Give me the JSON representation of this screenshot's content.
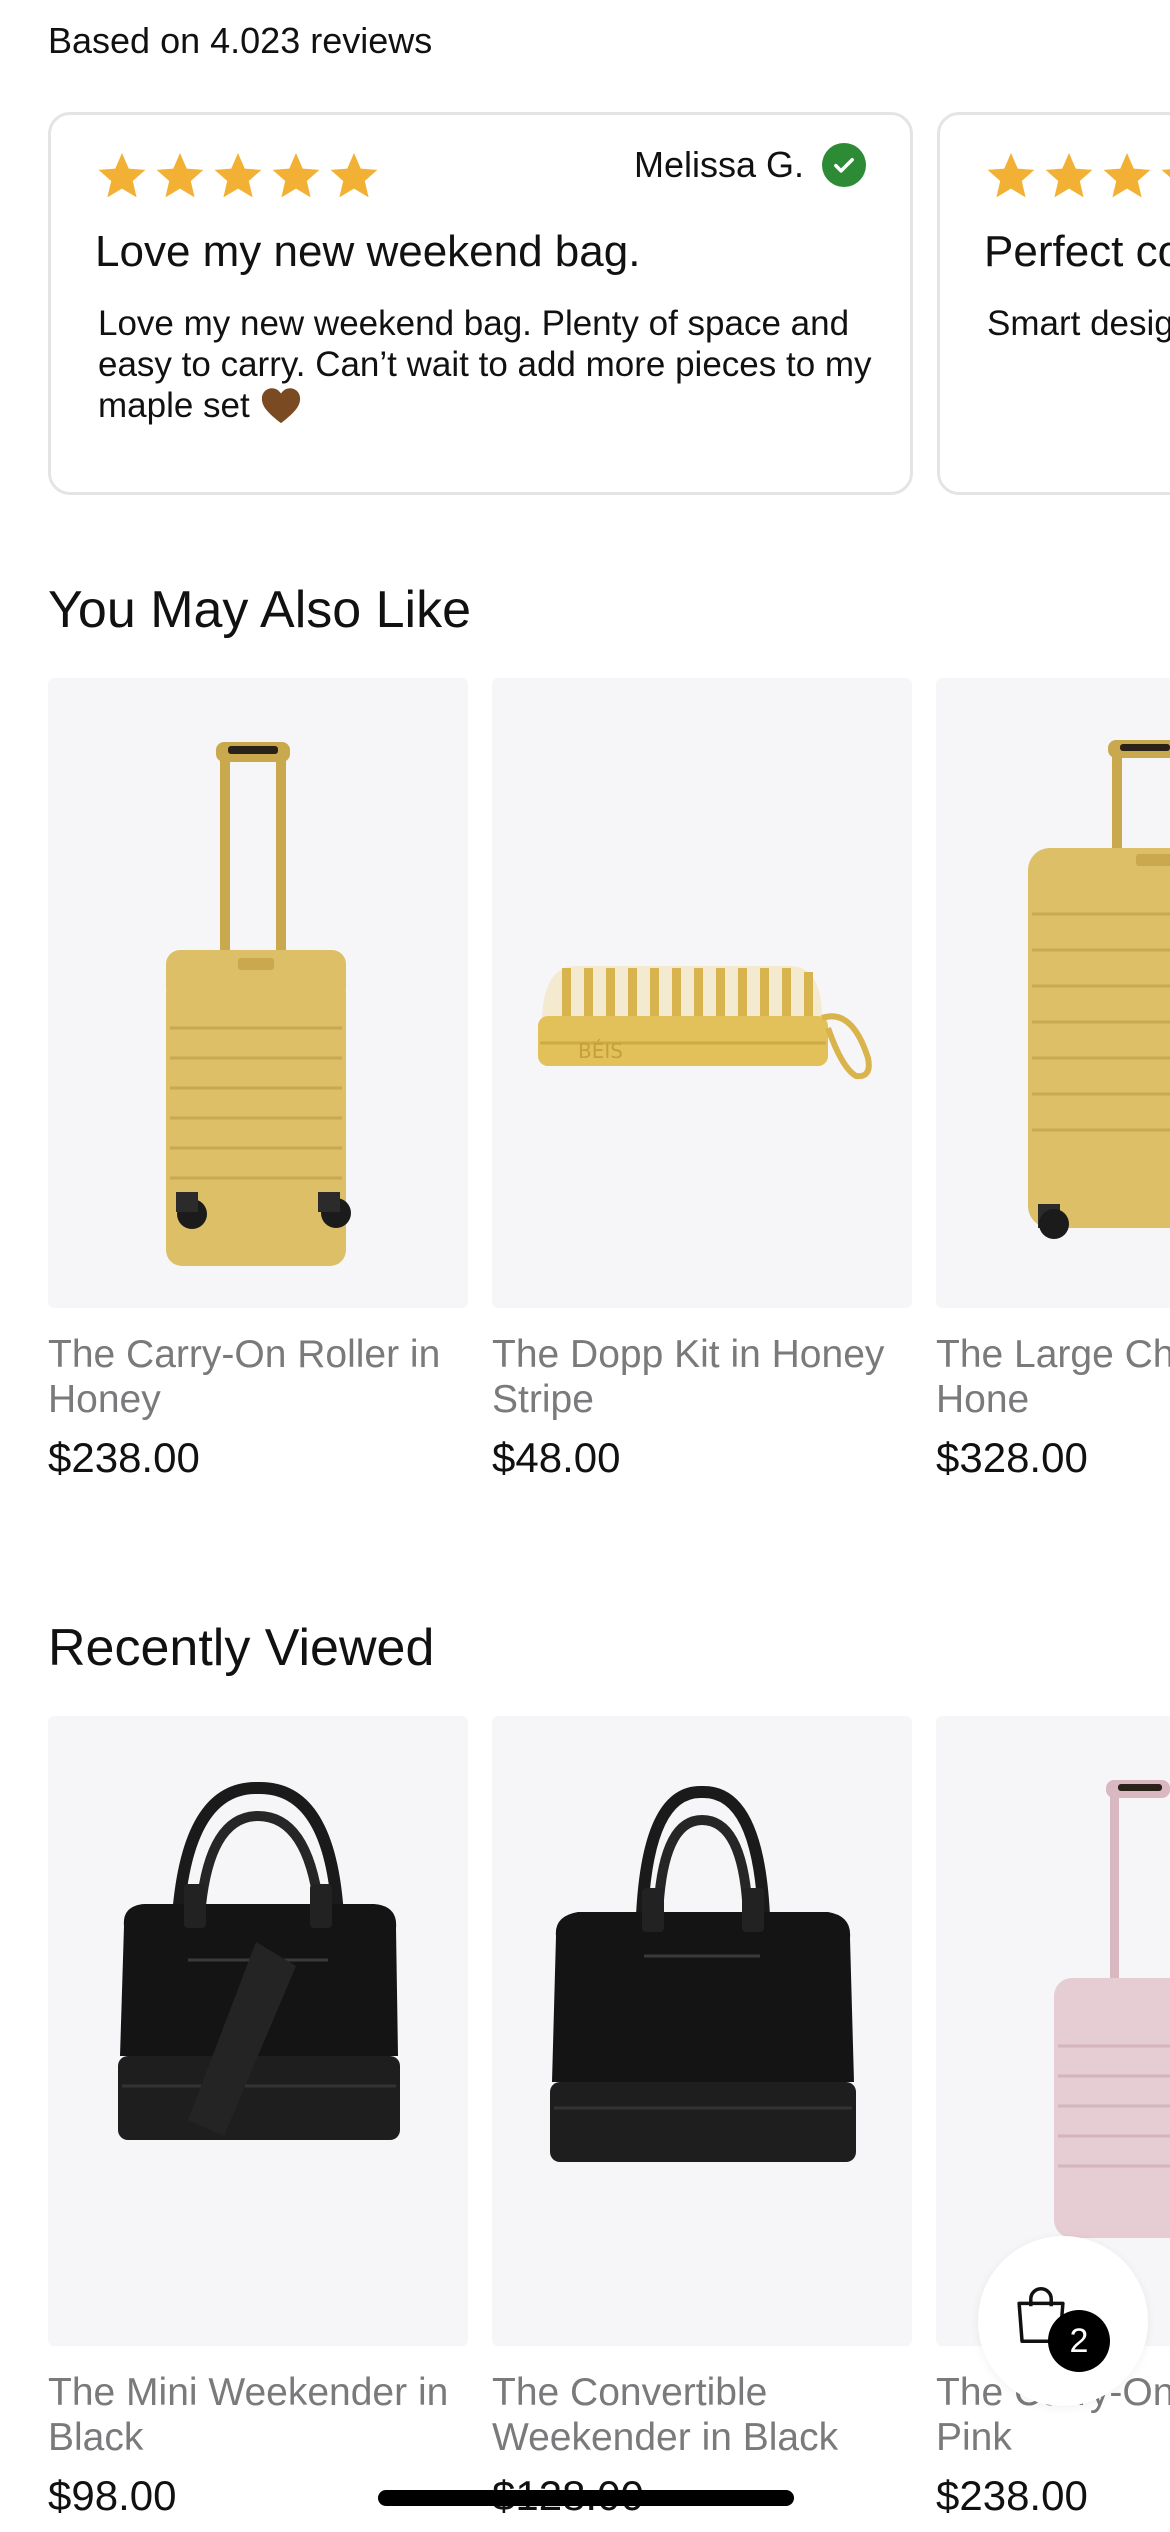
{
  "reviews": {
    "summary": "Based on 4.023 reviews",
    "colors": {
      "star": "#f2b134",
      "verified": "#2e8b35",
      "border": "#e4e4e6"
    },
    "cards": [
      {
        "rating": 5,
        "reviewer": "Melissa G.",
        "title": "Love my new weekend bag.",
        "body": "Love my new weekend bag. Plenty of space and easy to carry. Can’t wait to add more pieces to my maple set"
      },
      {
        "rating": 5,
        "reviewer": "",
        "title": "Perfect co",
        "body": "Smart desig seat."
      }
    ]
  },
  "you_may_also_like": {
    "title": "You May Also Like",
    "products": [
      {
        "name": "The Carry-On Roller in Honey",
        "price": "$238.00",
        "image_icon": "honey-carry-on-roller-image"
      },
      {
        "name": "The Dopp Kit in Honey Stripe",
        "price": "$48.00",
        "image_icon": "honey-stripe-dopp-kit-image"
      },
      {
        "name": "The Large Ch Roller in Hone",
        "price": "$328.00",
        "image_icon": "honey-large-roller-image"
      }
    ]
  },
  "recently_viewed": {
    "title": "Recently Viewed",
    "products": [
      {
        "name": "The Mini Weekender in Black",
        "price": "$98.00",
        "image_icon": "black-mini-weekender-image"
      },
      {
        "name": "The Convertible Weekender in Black",
        "price": "$128.00",
        "image_icon": "black-convertible-weekender-image"
      },
      {
        "name": "The Carry-On Atlas Pink",
        "price": "$238.00",
        "image_icon": "atlas-pink-carry-on-image"
      }
    ]
  },
  "cart": {
    "count": "2",
    "icon": "shopping-bag-icon"
  }
}
